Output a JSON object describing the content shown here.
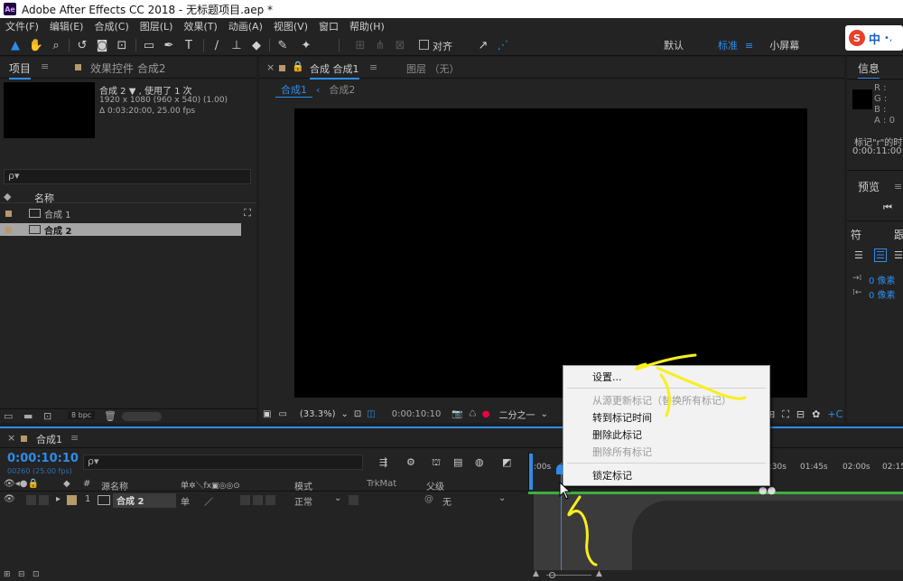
{
  "window": {
    "title": "Adobe After Effects CC 2018 - 无标题项目.aep *",
    "logo": "Ae"
  },
  "menu": [
    "文件(F)",
    "编辑(E)",
    "合成(C)",
    "图层(L)",
    "效果(T)",
    "动画(A)",
    "视图(V)",
    "窗口",
    "帮助(H)"
  ],
  "toolbar": {
    "align_label": "对齐"
  },
  "workspaces": {
    "default": "默认",
    "standard": "标准",
    "small": "小屏幕",
    "more": "»"
  },
  "ime": {
    "logo": "S",
    "lang": "中",
    "extra": "•,"
  },
  "project_panel": {
    "tab_project": "项目",
    "tab_effects": "效果控件 合成2",
    "info_name": "合成 2 ▼ , 使用了 1 次",
    "info_size": "1920 x 1080  (960 x 540) (1.00)",
    "info_duration": "Δ 0:03:20:00, 25.00 fps",
    "search_placeholder": "ρ▾",
    "col_name": "名称",
    "items": [
      {
        "name": "合成 1",
        "selected": false
      },
      {
        "name": "合成 2",
        "selected": true
      }
    ],
    "bpc": "8 bpc"
  },
  "composition_panel": {
    "tab_comp": "合成 合成1",
    "tab_layer": "图层 （无）",
    "crumb_1": "合成1",
    "crumb_2": "合成2",
    "zoom": "(33.3%)",
    "timecode": "0:00:10:10",
    "resolution": "二分之一"
  },
  "info_panel": {
    "title": "信息",
    "r": "R :",
    "g": "G :",
    "b": "B :",
    "a": "A : 0",
    "marker_text": "标记\"r\"的时",
    "marker_time": "0:00:11:00",
    "preview_title": "预览",
    "char_tab": "符",
    "para_tab": "跟",
    "px1": "0 像素",
    "px2": "0 像素"
  },
  "timeline": {
    "tab": "合成1",
    "timecode": "0:00:10:10",
    "frames": "00260 (25.00 fps)",
    "col_source": "源名称",
    "col_switches": "单✲＼fx▣◎◎⊙",
    "col_mode": "模式",
    "col_trkmat": "TrkMat",
    "col_parent": "父级",
    "layer": {
      "index": "1",
      "name": "合成 2",
      "switch": "单",
      "mode": "正常",
      "parent": "无"
    },
    "ruler": [
      ":00s",
      "0:30s",
      "01:45s",
      "02:00s",
      "02:15"
    ]
  },
  "context_menu": {
    "items": [
      {
        "label": "设置...",
        "enabled": true
      },
      {
        "label": "从源更新标记（替换所有标记）",
        "enabled": false
      },
      {
        "label": "转到标记时间",
        "enabled": true
      },
      {
        "label": "删除此标记",
        "enabled": true
      },
      {
        "label": "删除所有标记",
        "enabled": false
      },
      {
        "label": "锁定标记",
        "enabled": true
      }
    ]
  },
  "colors": {
    "accent": "#2d8ceb",
    "annotation": "#f7ef1b",
    "panel": "#232323"
  }
}
